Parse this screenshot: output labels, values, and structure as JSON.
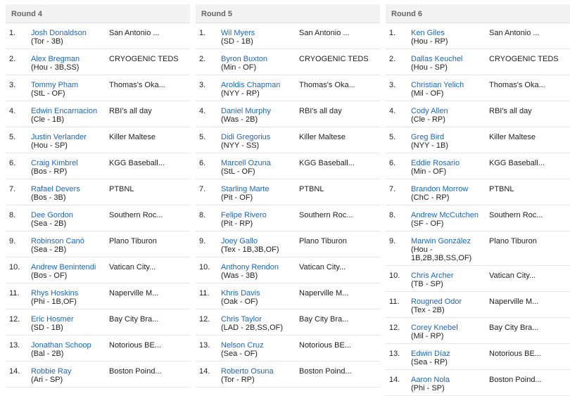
{
  "rounds": [
    {
      "label": "Round 4",
      "picks": [
        {
          "num": "1.",
          "player": "Josh Donaldson",
          "meta": "(Tor - 3B)",
          "team": "San Antonio ..."
        },
        {
          "num": "2.",
          "player": "Alex Bregman",
          "meta": "(Hou - 3B,SS)",
          "team": "CRYOGENIC TEDS"
        },
        {
          "num": "3.",
          "player": "Tommy Pham",
          "meta": "(StL - OF)",
          "team": "Thomas's Oka..."
        },
        {
          "num": "4.",
          "player": "Edwin Encarnacion",
          "meta": "(Cle - 1B)",
          "team": "RBI's all day"
        },
        {
          "num": "5.",
          "player": "Justin Verlander",
          "meta": "(Hou - SP)",
          "team": "Killer Maltese"
        },
        {
          "num": "6.",
          "player": "Craig Kimbrel",
          "meta": "(Bos - RP)",
          "team": "KGG Baseball..."
        },
        {
          "num": "7.",
          "player": "Rafael Devers",
          "meta": "(Bos - 3B)",
          "team": "PTBNL"
        },
        {
          "num": "8.",
          "player": "Dee Gordon",
          "meta": "(Sea - 2B)",
          "team": "Southern Roc..."
        },
        {
          "num": "9.",
          "player": "Robinson Canó",
          "meta": "(Sea - 2B)",
          "team": "Plano Tiburon"
        },
        {
          "num": "10.",
          "player": "Andrew Benintendi",
          "meta": "(Bos - OF)",
          "team": "Vatican City..."
        },
        {
          "num": "11.",
          "player": "Rhys Hoskins",
          "meta": "(Phi - 1B,OF)",
          "team": "Naperville M..."
        },
        {
          "num": "12.",
          "player": "Eric Hosmer",
          "meta": "(SD - 1B)",
          "team": "Bay City Bra..."
        },
        {
          "num": "13.",
          "player": "Jonathan Schoop",
          "meta": "(Bal - 2B)",
          "team": "Notorious BE..."
        },
        {
          "num": "14.",
          "player": "Robbie Ray",
          "meta": "(Ari - SP)",
          "team": "Boston Poind..."
        }
      ]
    },
    {
      "label": "Round 5",
      "picks": [
        {
          "num": "1.",
          "player": "Wil Myers",
          "meta": "(SD - 1B)",
          "team": "San Antonio ..."
        },
        {
          "num": "2.",
          "player": "Byron Buxton",
          "meta": "(Min - OF)",
          "team": "CRYOGENIC TEDS"
        },
        {
          "num": "3.",
          "player": "Aroldis Chapman",
          "meta": "(NYY - RP)",
          "team": "Thomas's Oka..."
        },
        {
          "num": "4.",
          "player": "Daniel Murphy",
          "meta": "(Was - 2B)",
          "team": "RBI's all day"
        },
        {
          "num": "5.",
          "player": "Didi Gregorius",
          "meta": "(NYY - SS)",
          "team": "Killer Maltese"
        },
        {
          "num": "6.",
          "player": "Marcell Ozuna",
          "meta": "(StL - OF)",
          "team": "KGG Baseball..."
        },
        {
          "num": "7.",
          "player": "Starling Marte",
          "meta": "(Pit - OF)",
          "team": "PTBNL"
        },
        {
          "num": "8.",
          "player": "Felipe Rivero",
          "meta": "(Pit - RP)",
          "team": "Southern Roc..."
        },
        {
          "num": "9.",
          "player": "Joey Gallo",
          "meta": "(Tex - 1B,3B,OF)",
          "team": "Plano Tiburon"
        },
        {
          "num": "10.",
          "player": "Anthony Rendon",
          "meta": "(Was - 3B)",
          "team": "Vatican City..."
        },
        {
          "num": "11.",
          "player": "Khris Davis",
          "meta": "(Oak - OF)",
          "team": "Naperville M..."
        },
        {
          "num": "12.",
          "player": "Chris Taylor",
          "meta": "(LAD - 2B,SS,OF)",
          "team": "Bay City Bra..."
        },
        {
          "num": "13.",
          "player": "Nelson Cruz",
          "meta": "(Sea - OF)",
          "team": "Notorious BE..."
        },
        {
          "num": "14.",
          "player": "Roberto Osuna",
          "meta": "(Tor - RP)",
          "team": "Boston Poind..."
        }
      ]
    },
    {
      "label": "Round 6",
      "picks": [
        {
          "num": "1.",
          "player": "Ken Giles",
          "meta": "(Hou - RP)",
          "team": "San Antonio ..."
        },
        {
          "num": "2.",
          "player": "Dallas Keuchel",
          "meta": "(Hou - SP)",
          "team": "CRYOGENIC TEDS"
        },
        {
          "num": "3.",
          "player": "Christian Yelich",
          "meta": "(Mil - OF)",
          "team": "Thomas's Oka..."
        },
        {
          "num": "4.",
          "player": "Cody Allen",
          "meta": "(Cle - RP)",
          "team": "RBI's all day"
        },
        {
          "num": "5.",
          "player": "Greg Bird",
          "meta": "(NYY - 1B)",
          "team": "Killer Maltese"
        },
        {
          "num": "6.",
          "player": "Eddie Rosario",
          "meta": "(Min - OF)",
          "team": "KGG Baseball..."
        },
        {
          "num": "7.",
          "player": "Brandon Morrow",
          "meta": "(ChC - RP)",
          "team": "PTBNL"
        },
        {
          "num": "8.",
          "player": "Andrew McCutchen",
          "meta": "(SF - OF)",
          "team": "Southern Roc..."
        },
        {
          "num": "9.",
          "player": "Marwin González",
          "meta": "(Hou - 1B,2B,3B,SS,OF)",
          "team": "Plano Tiburon"
        },
        {
          "num": "10.",
          "player": "Chris Archer",
          "meta": "(TB - SP)",
          "team": "Vatican City..."
        },
        {
          "num": "11.",
          "player": "Rougned Odor",
          "meta": "(Tex - 2B)",
          "team": "Naperville M..."
        },
        {
          "num": "12.",
          "player": "Corey Knebel",
          "meta": "(Mil - RP)",
          "team": "Bay City Bra..."
        },
        {
          "num": "13.",
          "player": "Edwin Díaz",
          "meta": "(Sea - RP)",
          "team": "Notorious BE..."
        },
        {
          "num": "14.",
          "player": "Aaron Nola",
          "meta": "(Phi - SP)",
          "team": "Boston Poind..."
        }
      ]
    }
  ]
}
